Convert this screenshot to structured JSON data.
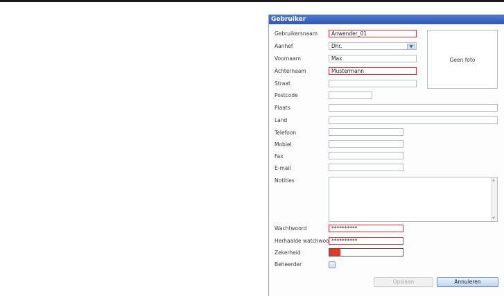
{
  "dialog": {
    "title": "Gebruiker",
    "photo_placeholder": "Geen foto",
    "fields": {
      "gebruikersnaam": {
        "label": "Gebruikersnaam",
        "value": "Anwender_01",
        "required": true
      },
      "aanhef": {
        "label": "Aanhef",
        "value": "Dhr."
      },
      "voornaam": {
        "label": "Voornaam",
        "value": "Max"
      },
      "achternaam": {
        "label": "Achternaam",
        "value": "Mustermann",
        "required": true
      },
      "straat": {
        "label": "Straat",
        "value": ""
      },
      "postcode": {
        "label": "Postcode",
        "value": ""
      },
      "plaats": {
        "label": "Plaats",
        "value": ""
      },
      "land": {
        "label": "Land",
        "value": ""
      },
      "telefoon": {
        "label": "Telefoon",
        "value": ""
      },
      "mobiel": {
        "label": "Mobiel",
        "value": ""
      },
      "fax": {
        "label": "Fax",
        "value": ""
      },
      "email": {
        "label": "E-mail",
        "value": ""
      },
      "notities": {
        "label": "Notities",
        "value": ""
      },
      "wachtwoord": {
        "label": "Wachtwoord",
        "value": "**********",
        "required": true
      },
      "herhaalde_wachtwoord": {
        "label": "Herhaalde watchwoord",
        "value": "**********",
        "required": true
      }
    },
    "zekerheid": {
      "label": "Zekerheid",
      "level": 0.15,
      "color": "#e53822"
    },
    "beheerder": {
      "label": "Beheerder",
      "checked": false
    },
    "buttons": {
      "save": "Opslaan",
      "cancel": "Annuleren"
    },
    "colors": {
      "title_bar": "#2f58b4",
      "required_border": "#e0303a",
      "field_border": "#b4b8bf"
    }
  }
}
